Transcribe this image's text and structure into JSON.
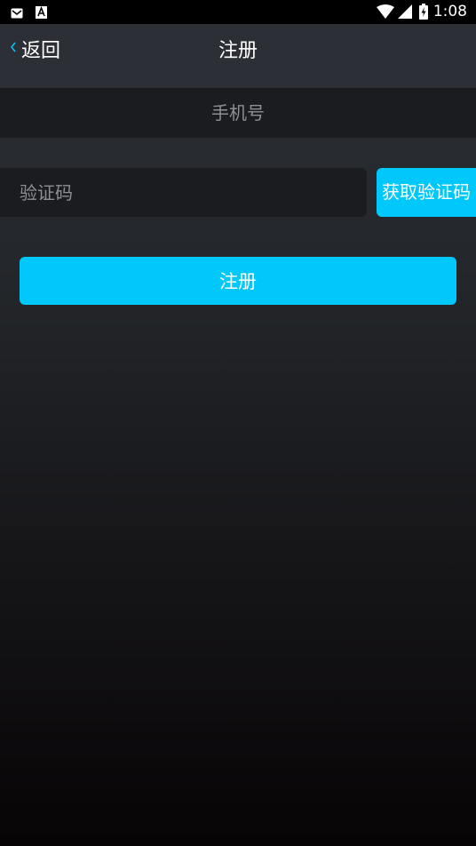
{
  "status_bar": {
    "time": "1:08",
    "icons": [
      "mail-icon",
      "font-a-icon",
      "wifi-icon",
      "signal-icon",
      "battery-charging-icon"
    ]
  },
  "nav": {
    "back_label": "返回",
    "title": "注册"
  },
  "form": {
    "phone_placeholder": "手机号",
    "phone_value": "",
    "code_placeholder": "验证码",
    "code_value": "",
    "get_code_label": "获取验证码",
    "register_label": "注册"
  },
  "colors": {
    "accent": "#00c8fa",
    "nav_bg": "#2c2f35",
    "input_bg": "#1b1c1f",
    "placeholder": "#8d8f93",
    "back_chevron": "#00c8fa"
  }
}
